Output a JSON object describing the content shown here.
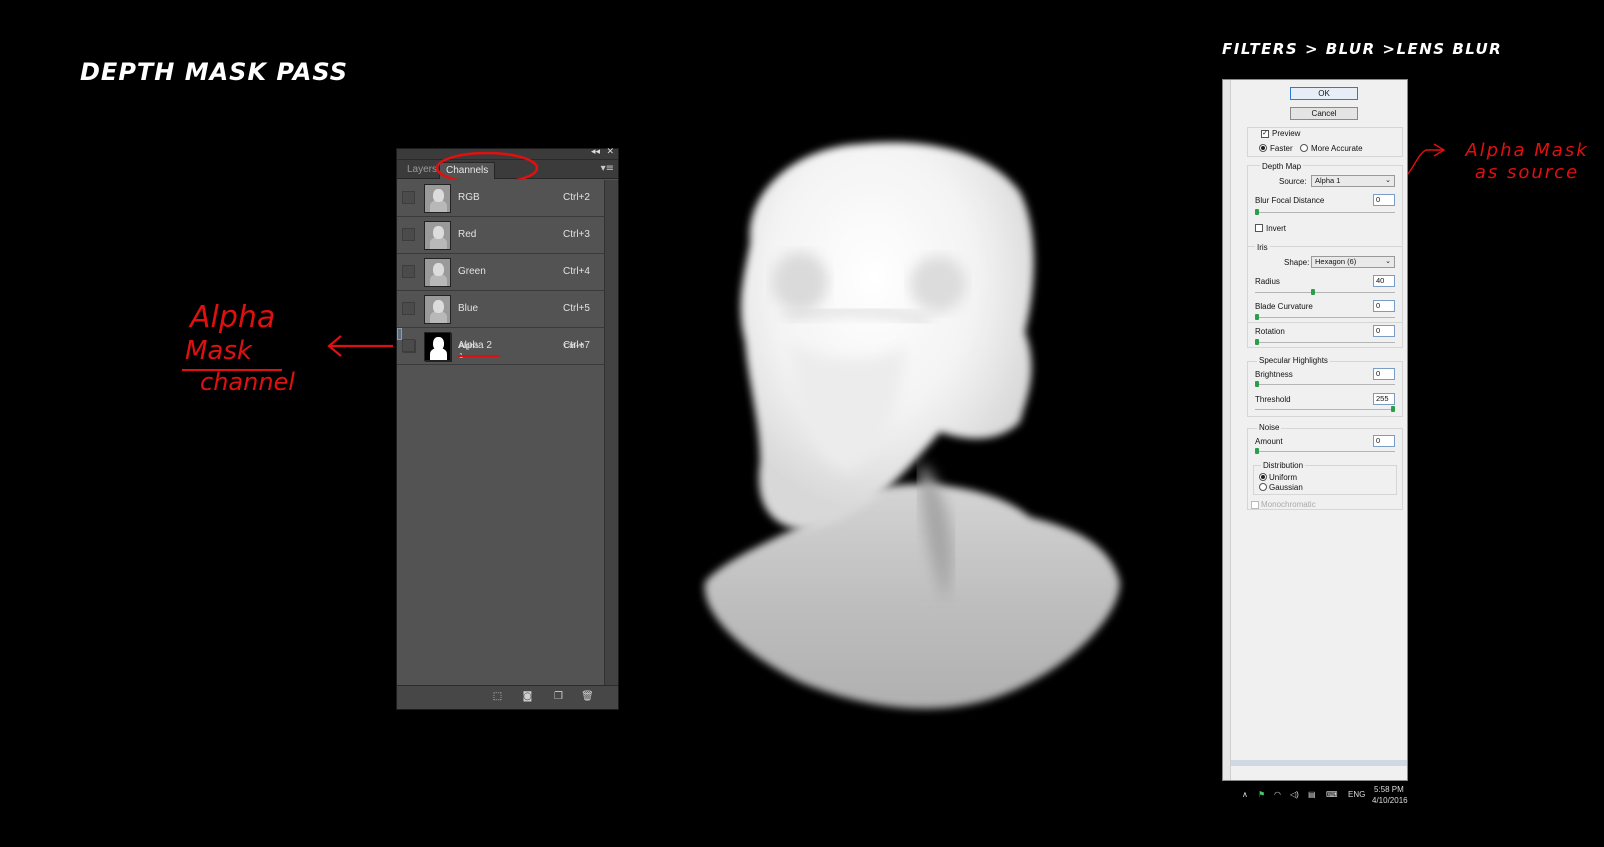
{
  "headings": {
    "left": "Depth Mask Pass",
    "right": "Filters > Blur >Lens Blur"
  },
  "annotations": {
    "alpha_mask_channel": [
      "Alpha",
      "Mask",
      "channel"
    ],
    "alpha_mask_source": [
      "Alpha Mask",
      "as source"
    ]
  },
  "channels_panel": {
    "tabs": [
      "Layers",
      "Channels"
    ],
    "active_tab": "Channels",
    "rows": [
      {
        "name": "RGB",
        "shortcut": "Ctrl+2"
      },
      {
        "name": "Red",
        "shortcut": "Ctrl+3"
      },
      {
        "name": "Green",
        "shortcut": "Ctrl+4"
      },
      {
        "name": "Blue",
        "shortcut": "Ctrl+5"
      },
      {
        "name": "Alpha 1",
        "shortcut": "Ctrl+6"
      },
      {
        "name": "Alpha 2",
        "shortcut": "Ctrl+7"
      }
    ],
    "selected_row": "Alpha 1"
  },
  "lens_blur": {
    "ok": "OK",
    "cancel": "Cancel",
    "preview": "Preview",
    "faster": "Faster",
    "more_accurate": "More Accurate",
    "depth_map": "Depth Map",
    "source_label": "Source:",
    "source_value": "Alpha 1",
    "blur_focal_distance": "Blur Focal Distance",
    "blur_focal_distance_value": "0",
    "invert": "Invert",
    "iris": "Iris",
    "shape_label": "Shape:",
    "shape_value": "Hexagon (6)",
    "radius": "Radius",
    "radius_value": "40",
    "blade_curvature": "Blade Curvature",
    "blade_curvature_value": "0",
    "rotation": "Rotation",
    "rotation_value": "0",
    "specular_highlights": "Specular Highlights",
    "brightness": "Brightness",
    "brightness_value": "0",
    "threshold": "Threshold",
    "threshold_value": "255",
    "noise": "Noise",
    "amount": "Amount",
    "amount_value": "0",
    "distribution": "Distribution",
    "uniform": "Uniform",
    "gaussian": "Gaussian",
    "monochromatic": "Monochromatic"
  },
  "taskbar": {
    "lang": "ENG",
    "time": "5:58 PM",
    "date": "4/10/2016"
  }
}
